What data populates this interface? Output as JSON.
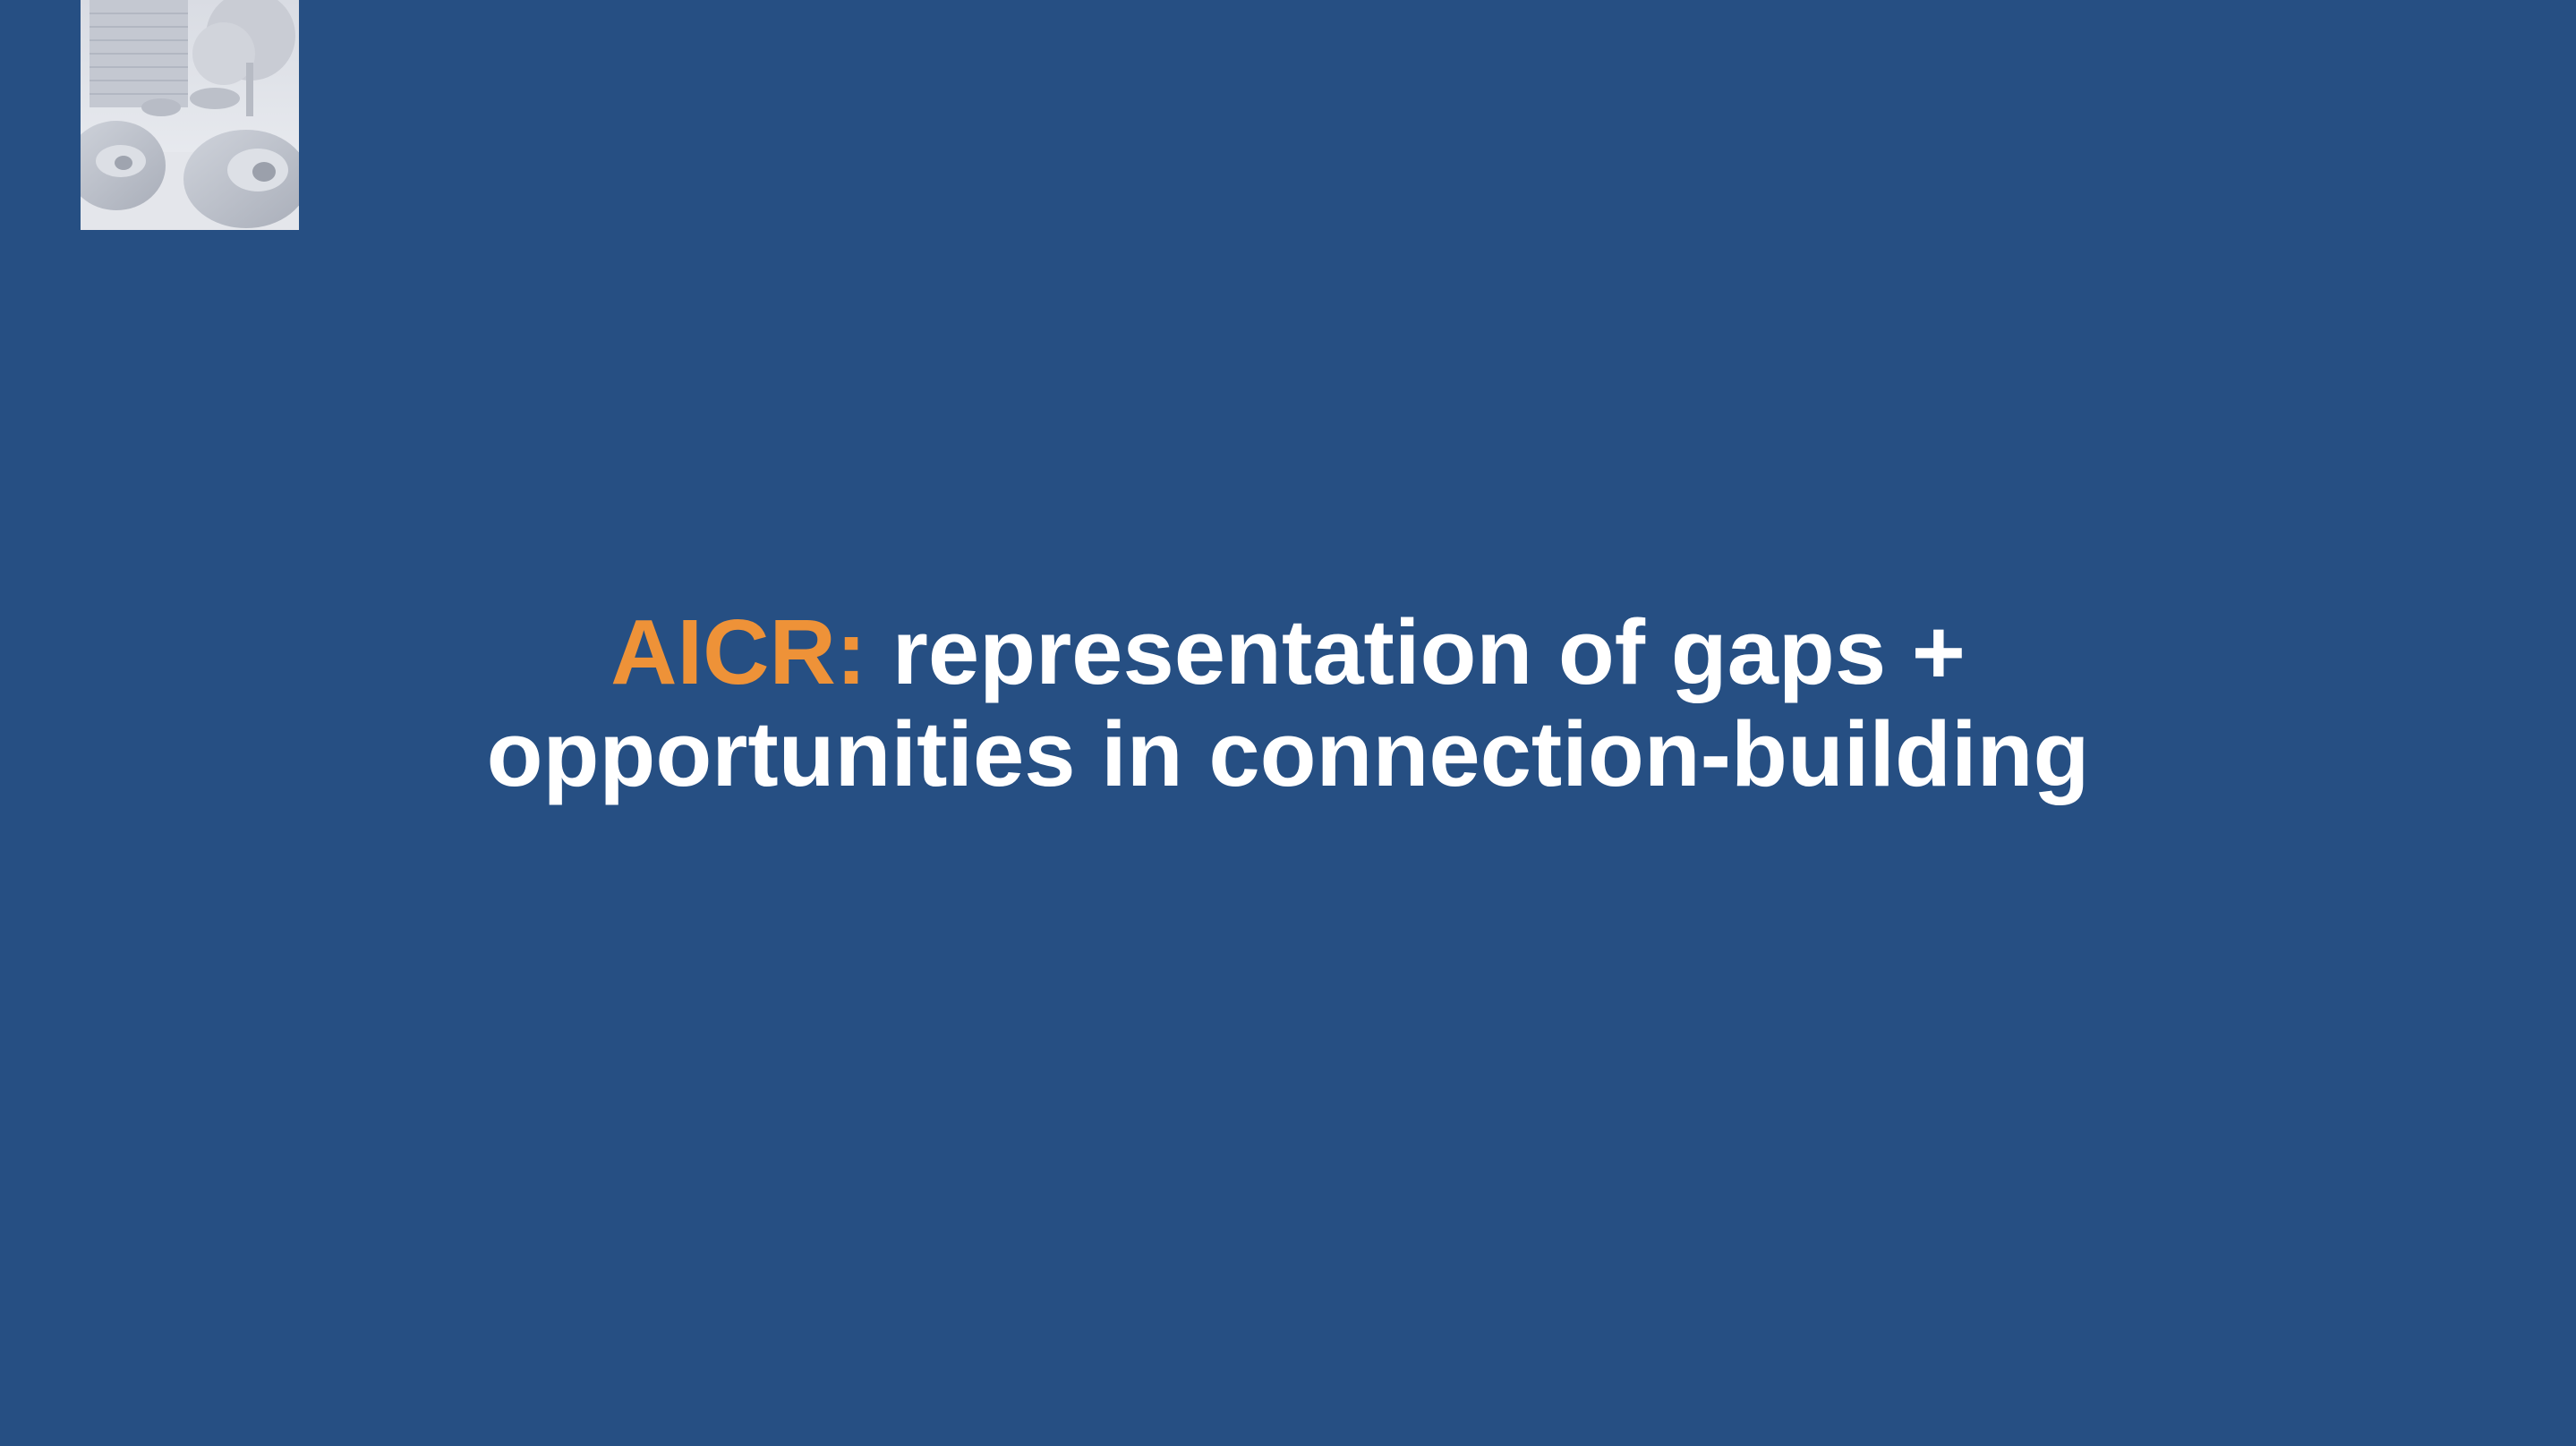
{
  "slide": {
    "background_color": "#264f83",
    "logo_image": {
      "description_icon": "sculpture-photo-icon"
    },
    "title": {
      "prefix": "AICR:",
      "prefix_color": "#ee9238",
      "line1_rest": " representation of gaps +",
      "line2": "opportunities in connection-building",
      "text_color": "#ffffff"
    }
  }
}
